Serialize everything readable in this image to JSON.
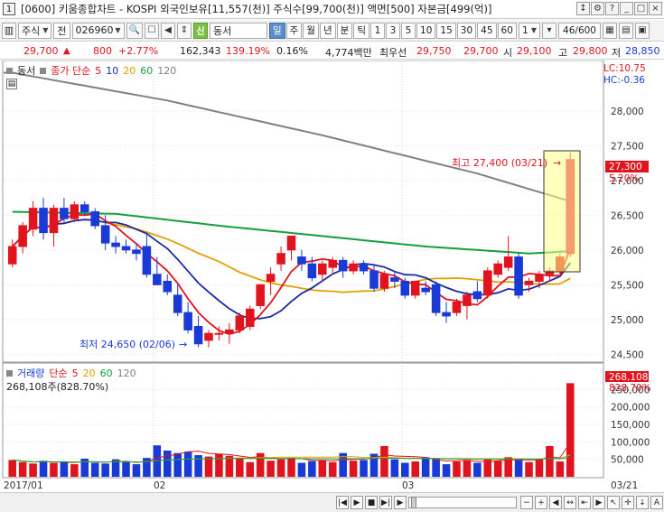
{
  "window": {
    "number": "1",
    "title": "[0600] 키움종합차트 - KOSPI 외국인보유[11,557(천)] 주식수[99,700(천)] 액면[500] 자본금[499(억)]"
  },
  "toolbar": {
    "market": "주식",
    "search_label": "전",
    "code": "026960",
    "stock_name": "동서",
    "periods": [
      "일",
      "주",
      "월",
      "년",
      "분",
      "틱",
      "1",
      "3",
      "5",
      "10",
      "15",
      "30",
      "45",
      "60"
    ],
    "active_period": "일",
    "interval": "1",
    "count": "46/600",
    "green_btn": "신"
  },
  "quote": {
    "price": "29,700",
    "change": "800",
    "change_pct": "+2.77%",
    "volume": "162,343",
    "vol_ratio": "139.19%",
    "turnover": "0.16%",
    "amount": "4,774백만",
    "bid_label": "최우선",
    "bid1": "29,750",
    "bid2": "29,700",
    "open_label": "시",
    "open": "29,100",
    "high_label": "고",
    "high": "29,800",
    "low_label": "저",
    "low": "28,850"
  },
  "price_panel": {
    "name_label": "동서",
    "ma_label": "종가 단순",
    "ma_periods": [
      "5",
      "10",
      "20",
      "60",
      "120"
    ],
    "lc": "LC:10.75",
    "hc": "HC:-0.36",
    "y_ticks": [
      "28,000",
      "27,500",
      "27,000",
      "26,500",
      "26,000",
      "25,500",
      "25,000",
      "24,500"
    ],
    "cur_price_tag": "27,300",
    "cur_pct_tag": "5.20%",
    "max_label": "최고 27,400 (03/21)",
    "min_label": "최저 24,650 (02/06)"
  },
  "volume_panel": {
    "label": "거래량",
    "ma_label": "단순",
    "ma_periods": [
      "5",
      "20",
      "60",
      "120"
    ],
    "info": "268,108주(828.70%)",
    "cur_tag": "268,108",
    "cur_pct": "828.70%",
    "y_ticks": [
      "250,000",
      "200,000",
      "150,000",
      "100,000",
      "50,000"
    ]
  },
  "x_labels": [
    "2017/01",
    "02",
    "03",
    "03/21"
  ],
  "colors": {
    "up": "#e0141e",
    "down": "#1a3ad6",
    "ma5": "#e0141e",
    "ma10": "#1a2aa0",
    "ma20": "#e0a000",
    "ma60": "#14a03c",
    "ma120": "#808080"
  },
  "chart_data": {
    "type": "candlestick",
    "ylim": [
      24400,
      28700
    ],
    "candles": [
      {
        "o": 25800,
        "h": 26150,
        "l": 25750,
        "c": 26050
      },
      {
        "o": 26050,
        "h": 26400,
        "l": 25950,
        "c": 26350
      },
      {
        "o": 26300,
        "h": 26700,
        "l": 26200,
        "c": 26600
      },
      {
        "o": 26600,
        "h": 26750,
        "l": 26150,
        "c": 26250
      },
      {
        "o": 26250,
        "h": 26650,
        "l": 26050,
        "c": 26600
      },
      {
        "o": 26600,
        "h": 26750,
        "l": 26400,
        "c": 26450
      },
      {
        "o": 26450,
        "h": 26700,
        "l": 26400,
        "c": 26650
      },
      {
        "o": 26650,
        "h": 26700,
        "l": 26500,
        "c": 26550
      },
      {
        "o": 26550,
        "h": 26600,
        "l": 26300,
        "c": 26350
      },
      {
        "o": 26350,
        "h": 26500,
        "l": 26000,
        "c": 26100
      },
      {
        "o": 26100,
        "h": 26200,
        "l": 25950,
        "c": 26050
      },
      {
        "o": 26050,
        "h": 26150,
        "l": 25950,
        "c": 26000
      },
      {
        "o": 26000,
        "h": 26100,
        "l": 25850,
        "c": 25950
      },
      {
        "o": 26050,
        "h": 26250,
        "l": 25600,
        "c": 25650
      },
      {
        "o": 25650,
        "h": 25900,
        "l": 25500,
        "c": 25500
      },
      {
        "o": 25550,
        "h": 25650,
        "l": 25350,
        "c": 25400
      },
      {
        "o": 25350,
        "h": 25500,
        "l": 25050,
        "c": 25100
      },
      {
        "o": 25100,
        "h": 25250,
        "l": 24800,
        "c": 24850
      },
      {
        "o": 24900,
        "h": 25050,
        "l": 24600,
        "c": 24650
      },
      {
        "o": 24700,
        "h": 24850,
        "l": 24600,
        "c": 24800
      },
      {
        "o": 24800,
        "h": 24900,
        "l": 24700,
        "c": 24800
      },
      {
        "o": 24800,
        "h": 24950,
        "l": 24650,
        "c": 24850
      },
      {
        "o": 24850,
        "h": 25100,
        "l": 24800,
        "c": 25050
      },
      {
        "o": 24900,
        "h": 25200,
        "l": 24850,
        "c": 25150
      },
      {
        "o": 25200,
        "h": 25500,
        "l": 25150,
        "c": 25500
      },
      {
        "o": 25550,
        "h": 25750,
        "l": 25350,
        "c": 25650
      },
      {
        "o": 25800,
        "h": 26050,
        "l": 25700,
        "c": 25950
      },
      {
        "o": 26000,
        "h": 26200,
        "l": 25850,
        "c": 26200
      },
      {
        "o": 25900,
        "h": 26000,
        "l": 25700,
        "c": 25800
      },
      {
        "o": 25800,
        "h": 25900,
        "l": 25550,
        "c": 25600
      },
      {
        "o": 25650,
        "h": 25850,
        "l": 25550,
        "c": 25800
      },
      {
        "o": 25750,
        "h": 25900,
        "l": 25650,
        "c": 25850
      },
      {
        "o": 25850,
        "h": 25900,
        "l": 25600,
        "c": 25700
      },
      {
        "o": 25700,
        "h": 25850,
        "l": 25650,
        "c": 25800
      },
      {
        "o": 25800,
        "h": 25850,
        "l": 25650,
        "c": 25700
      },
      {
        "o": 25700,
        "h": 25800,
        "l": 25400,
        "c": 25450
      },
      {
        "o": 25450,
        "h": 25700,
        "l": 25400,
        "c": 25650
      },
      {
        "o": 25600,
        "h": 25700,
        "l": 25450,
        "c": 25550
      },
      {
        "o": 25550,
        "h": 25600,
        "l": 25300,
        "c": 25350
      },
      {
        "o": 25350,
        "h": 25550,
        "l": 25300,
        "c": 25550
      },
      {
        "o": 25450,
        "h": 25550,
        "l": 25350,
        "c": 25400
      },
      {
        "o": 25500,
        "h": 25550,
        "l": 25050,
        "c": 25100
      },
      {
        "o": 25100,
        "h": 25250,
        "l": 24950,
        "c": 25050
      },
      {
        "o": 25100,
        "h": 25300,
        "l": 25050,
        "c": 25250
      },
      {
        "o": 25200,
        "h": 25400,
        "l": 25000,
        "c": 25350
      },
      {
        "o": 25400,
        "h": 25550,
        "l": 25250,
        "c": 25300
      },
      {
        "o": 25350,
        "h": 25750,
        "l": 25300,
        "c": 25700
      },
      {
        "o": 25650,
        "h": 25850,
        "l": 25600,
        "c": 25800
      },
      {
        "o": 25750,
        "h": 26200,
        "l": 25700,
        "c": 25900
      },
      {
        "o": 25900,
        "h": 25950,
        "l": 25300,
        "c": 25350
      },
      {
        "o": 25500,
        "h": 25600,
        "l": 25400,
        "c": 25550
      },
      {
        "o": 25550,
        "h": 25700,
        "l": 25450,
        "c": 25650
      },
      {
        "o": 25650,
        "h": 25750,
        "l": 25550,
        "c": 25700
      },
      {
        "o": 25700,
        "h": 25950,
        "l": 25650,
        "c": 25900
      },
      {
        "o": 25950,
        "h": 27400,
        "l": 25900,
        "c": 27300
      }
    ],
    "volumes": [
      48000,
      42000,
      38000,
      46000,
      40000,
      44000,
      36000,
      52000,
      40000,
      38000,
      50000,
      42000,
      36000,
      54000,
      90000,
      75000,
      68000,
      72000,
      62000,
      58000,
      66000,
      60000,
      52000,
      42000,
      68000,
      46000,
      50000,
      54000,
      40000,
      45000,
      48000,
      42000,
      68000,
      46000,
      48000,
      66000,
      88000,
      50000,
      40000,
      44000,
      56000,
      52000,
      36000,
      44000,
      48000,
      40000,
      52000,
      46000,
      56000,
      48000,
      42000,
      50000,
      88000,
      44000,
      268108
    ],
    "ma120": [
      [
        0,
        28550
      ],
      [
        15,
        28150
      ],
      [
        30,
        27650
      ],
      [
        45,
        27100
      ],
      [
        54,
        26700
      ],
      [
        55,
        26600
      ]
    ],
    "ma60": [
      [
        0,
        26550
      ],
      [
        10,
        26520
      ],
      [
        20,
        26350
      ],
      [
        30,
        26200
      ],
      [
        40,
        26050
      ],
      [
        50,
        25950
      ],
      [
        55,
        25990
      ]
    ],
    "vol_max": 300000
  }
}
